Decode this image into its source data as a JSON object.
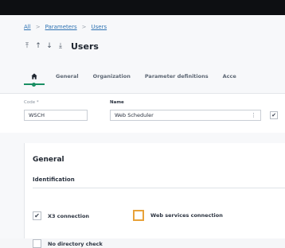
{
  "breadcrumb": {
    "root": "All",
    "parameters": "Parameters",
    "users": "Users",
    "separator": ">"
  },
  "header": {
    "title": "Users"
  },
  "tabs": {
    "home_icon": "home-icon",
    "items": [
      "General",
      "Organization",
      "Parameter definitions",
      "Acce"
    ]
  },
  "fields": {
    "code_label": "Code *",
    "code_value": "WSCH",
    "name_label": "Name",
    "name_value": "Web Scheduler",
    "lookup_glyph": "⋮",
    "active_checked": "✔"
  },
  "section": {
    "title": "General",
    "subtitle": "Identification"
  },
  "checks": {
    "x3_label": "X3 connection",
    "x3_mark": "✔",
    "ws_label": "Web services connection",
    "nodir_label": "No directory check"
  },
  "colors": {
    "accent": "#1a8f63",
    "focus": "#e8a23a",
    "link": "#2f73b3",
    "topbar": "#0d0f12"
  }
}
